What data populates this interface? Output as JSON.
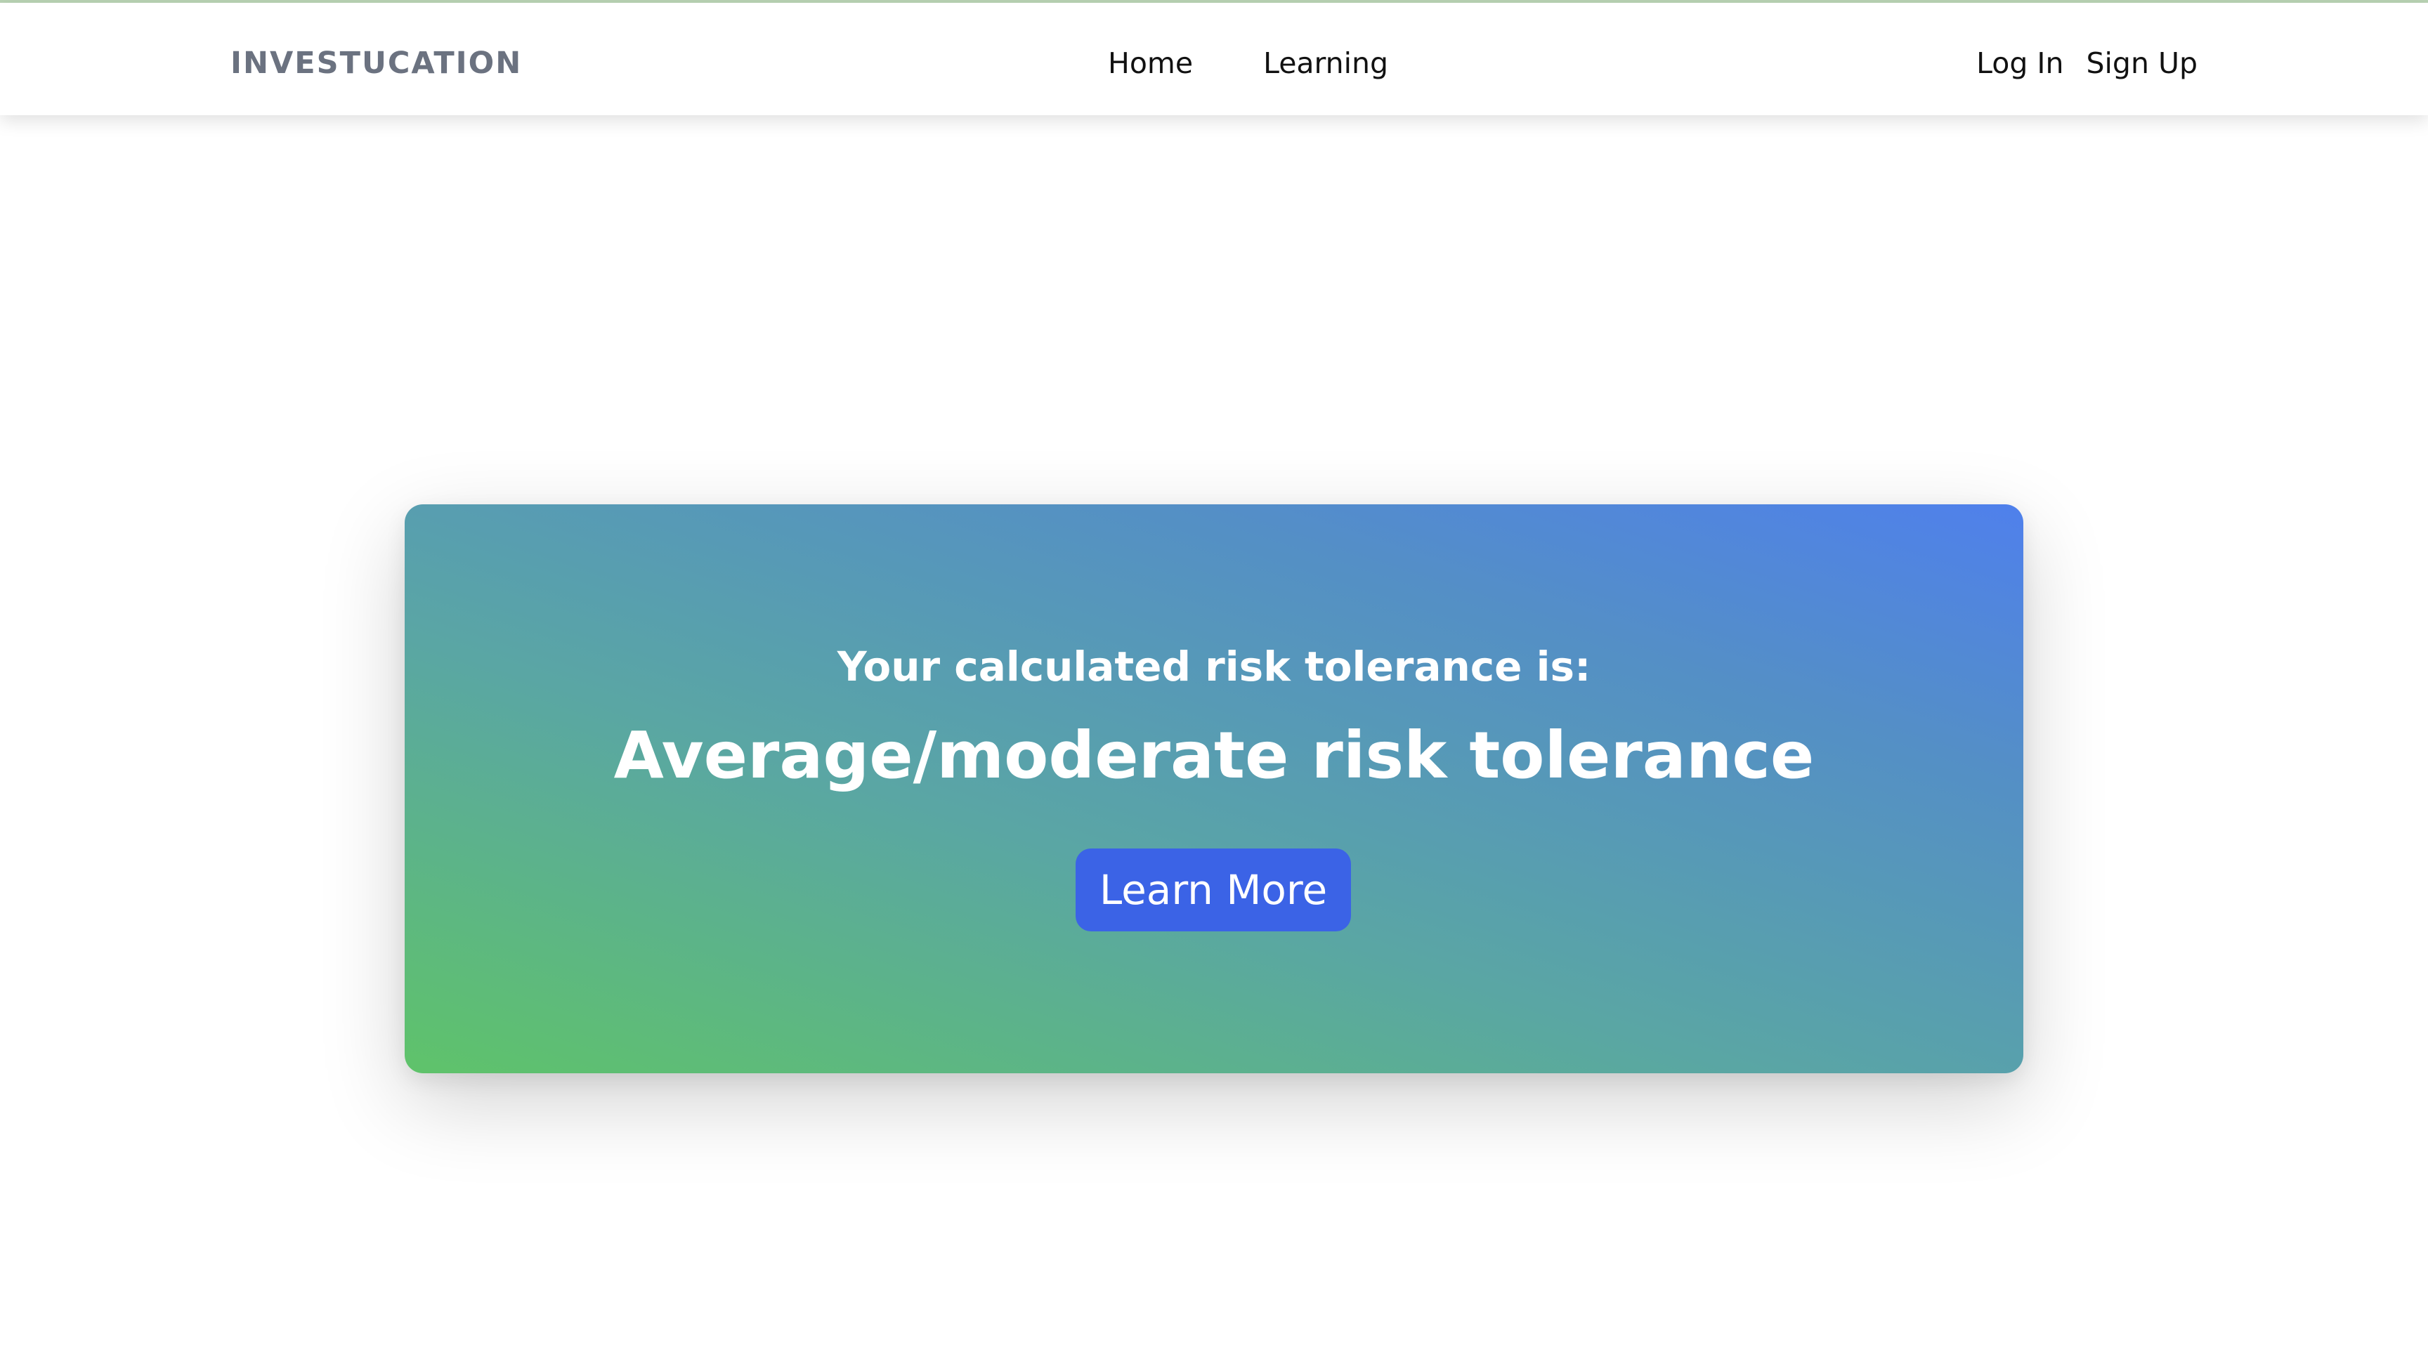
{
  "header": {
    "brand": "INVESTUCATION",
    "nav": {
      "home": "Home",
      "learning": "Learning"
    },
    "auth": {
      "login": "Log In",
      "signup": "Sign Up"
    }
  },
  "result_card": {
    "subtitle": "Your calculated risk tolerance is:",
    "result": "Average/moderate risk tolerance",
    "button_label": "Learn More"
  },
  "colors": {
    "gradient_start": "#5fc36a",
    "gradient_end": "#4f80ec",
    "button": "#3b63e6",
    "brand_text": "#6b7280"
  }
}
